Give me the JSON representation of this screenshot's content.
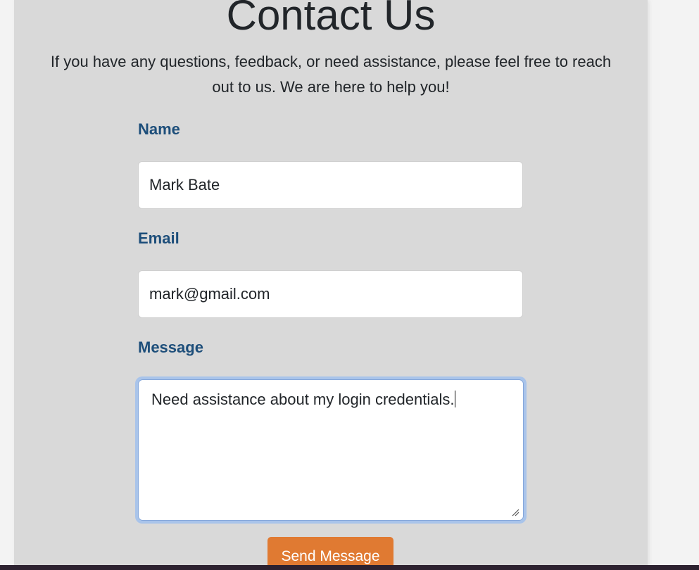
{
  "page": {
    "title": "Contact Us",
    "intro": "If you have any questions, feedback, or need assistance, please feel free to reach out to us. We are here to help you!"
  },
  "form": {
    "name_label": "Name",
    "name_value": "Mark Bate",
    "email_label": "Email",
    "email_value": "mark@gmail.com",
    "message_label": "Message",
    "message_value": "Need assistance about my login credentials.",
    "submit_label": "Send Message"
  },
  "colors": {
    "panel_bg": "#d9d9d9",
    "label_color": "#1d4e7a",
    "button_bg": "#e07a32",
    "focus_ring": "#a9c4ea"
  },
  "icons": {
    "textarea_grip": "resize-handle-icon"
  }
}
